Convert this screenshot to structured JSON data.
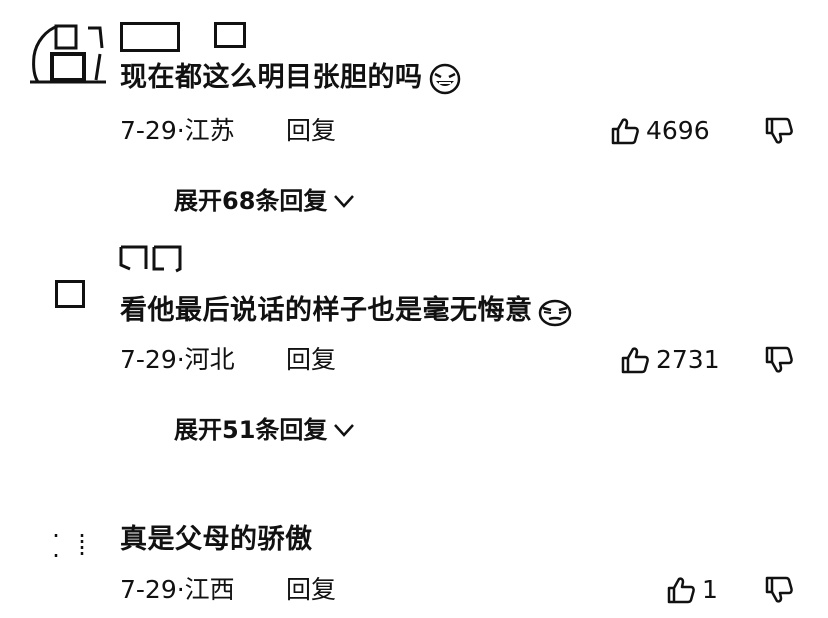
{
  "comments": [
    {
      "text": "现在都这么明目张胆的吗",
      "emoji_icon": "laughing-emoji-icon",
      "date_location": "7-29·江苏",
      "reply_label": "回复",
      "like_count": "4696",
      "expand_label": "展开68条回复"
    },
    {
      "text": "看他最后说话的样子也是毫无悔意",
      "emoji_icon": "smirk-emoji-icon",
      "date_location": "7-29·河北",
      "reply_label": "回复",
      "like_count": "2731",
      "expand_label": "展开51条回复"
    },
    {
      "text": "真是父母的骄傲",
      "date_location": "7-29·江西",
      "reply_label": "回复",
      "like_count": "1"
    }
  ],
  "icons": {
    "like": "thumbs-up-icon",
    "dislike": "thumbs-down-icon",
    "expand": "chevron-down-icon"
  },
  "colors": {
    "text": "#111111",
    "background": "#ffffff"
  }
}
